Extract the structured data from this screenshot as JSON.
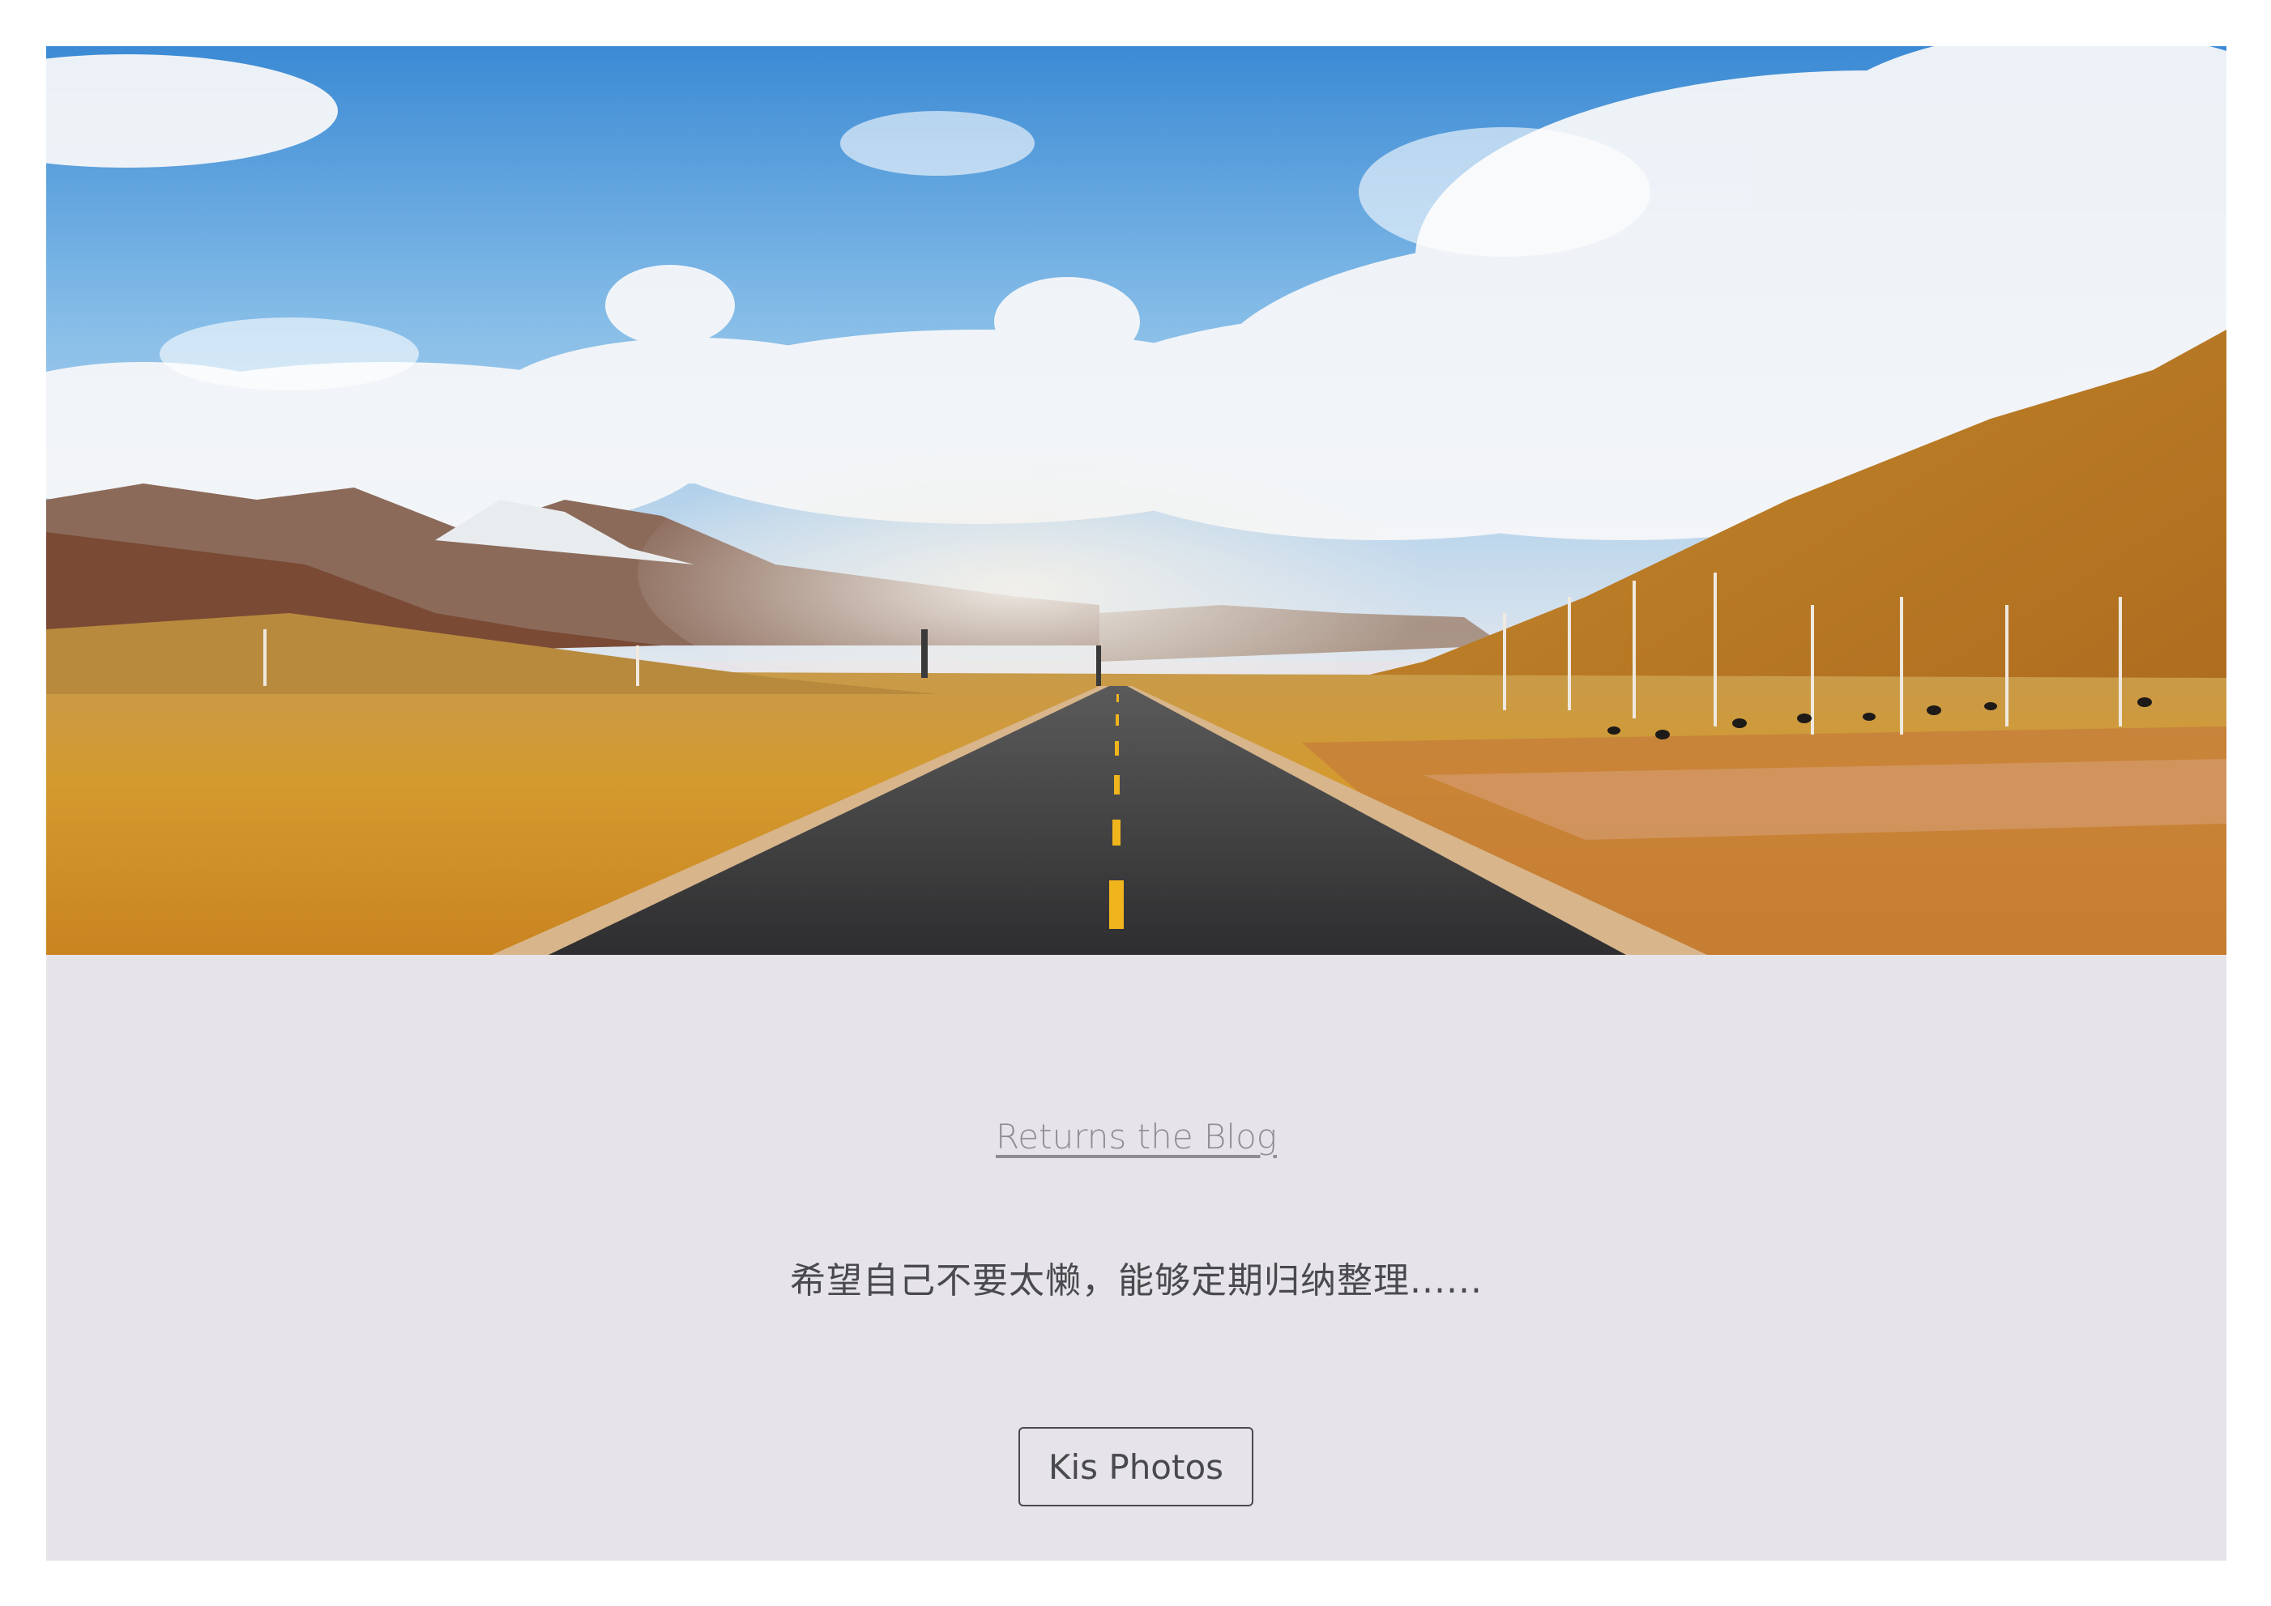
{
  "hero": {
    "image_description": "",
    "colors": {
      "sky_top": "#3f8fd6",
      "sky_mid": "#8cbfe8",
      "cloud": "#f4f5f7",
      "grass": "#cc8f2a",
      "road": "#3a3a3c",
      "lane_marking": "#f0b51c"
    }
  },
  "links": {
    "blog_link": "Returns the Blog"
  },
  "tagline": "希望自己不要太懒，能够定期归纳整理......",
  "buttons": {
    "photos_button": "Kis Photos"
  },
  "colors": {
    "page_background": "#e6e4e8",
    "link_gray": "#8f8d92",
    "text_dark": "#4a4a4e"
  }
}
